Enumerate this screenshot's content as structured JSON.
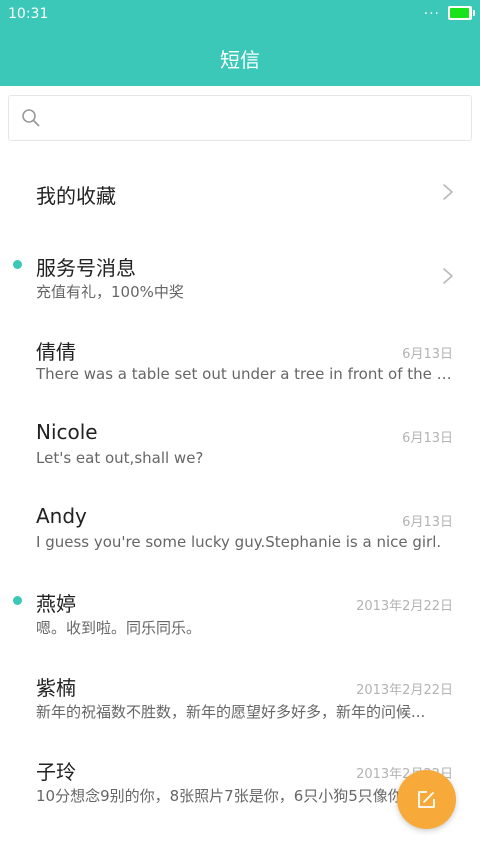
{
  "status_bar": {
    "time": "10:31",
    "dots": "...",
    "battery_level": 0.95
  },
  "header": {
    "title": "短信"
  },
  "search": {
    "placeholder": ""
  },
  "favorites": {
    "label": "我的收藏"
  },
  "service": {
    "name": "服务号消息",
    "preview": "充值有礼，100%中奖",
    "unread": true
  },
  "conversations": [
    {
      "name": "倩倩",
      "date": "6月13日",
      "preview": "There was a table set out under a tree in front of the ho...",
      "unread": false
    },
    {
      "name": "Nicole",
      "date": "6月13日",
      "preview": "Let's eat out,shall we?",
      "unread": false
    },
    {
      "name": "Andy",
      "date": "6月13日",
      "preview": "I guess you're some lucky guy.Stephanie is a nice girl.",
      "unread": false
    },
    {
      "name": "燕婷",
      "date": "2013年2月22日",
      "preview": "嗯。收到啦。同乐同乐。",
      "unread": true
    },
    {
      "name": "紫楠",
      "date": "2013年2月22日",
      "preview": "新年的祝福数不胜数，新年的愿望好多好多，新年的问候...",
      "unread": false
    },
    {
      "name": "子玲",
      "date": "2013年2月22日",
      "preview": "10分想念9别的你，8张照片7张是你，6只小狗5只像你",
      "unread": false
    }
  ],
  "colors": {
    "accent": "#3cc8b8",
    "fab": "#f7a93a",
    "battery": "#19e41b"
  },
  "icons": {
    "search": "search-icon",
    "chevron": "chevron-right-icon",
    "compose": "compose-icon"
  }
}
